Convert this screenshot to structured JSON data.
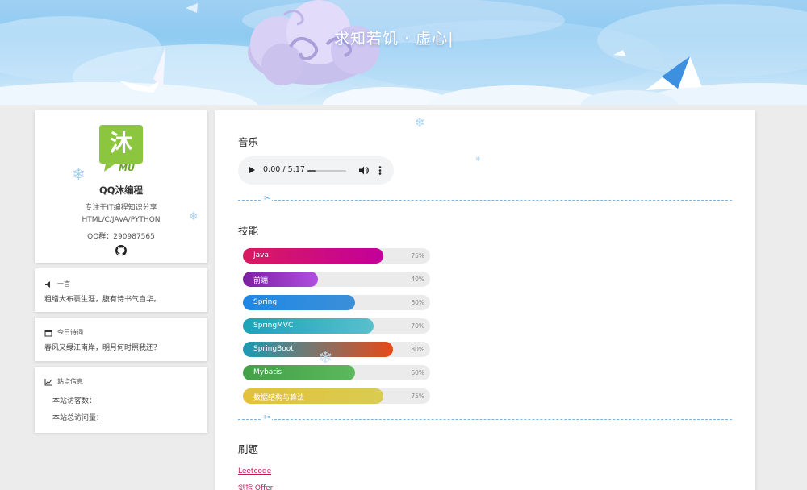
{
  "banner": {
    "title": "求知若饥 · 虚心|"
  },
  "profile": {
    "logo_text": "沐",
    "logo_sub": "MU",
    "name": "QQ沐编程",
    "tagline": "专注于IT编程知识分享",
    "languages": "HTML/C/JAVA/PYTHON",
    "qq_group": "QQ群：290987565",
    "icon": "github-icon"
  },
  "quote_card": {
    "title": "一言",
    "icon": "megaphone-icon",
    "text": "粗缯大布裹生涯，腹有诗书气自华。"
  },
  "poem_card": {
    "title": "今日诗词",
    "icon": "calendar-icon",
    "text": "春风又绿江南岸，明月何时照我还？"
  },
  "site_card": {
    "title": "站点信息",
    "icon": "chart-line-icon",
    "visitors": "本站访客数：",
    "views": "本站总访问量："
  },
  "music": {
    "title": "音乐",
    "time": "0:00 / 5:17",
    "progress": 0.2
  },
  "skills": {
    "title": "技能",
    "items": [
      {
        "name": "Java",
        "pct": "75%",
        "value": 0.75,
        "color": "linear-gradient(90deg,#d81b60,#c2009a)"
      },
      {
        "name": "前端",
        "pct": "40%",
        "value": 0.4,
        "color": "linear-gradient(90deg,#7b1fa2,#b04fe0)"
      },
      {
        "name": "Spring",
        "pct": "60%",
        "value": 0.6,
        "color": "linear-gradient(90deg,#1e88e5,#3c8fd8)"
      },
      {
        "name": "SpringMVC",
        "pct": "70%",
        "value": 0.7,
        "color": "linear-gradient(90deg,#1aa3b8,#58c0cc)"
      },
      {
        "name": "SpringBoot",
        "pct": "80%",
        "value": 0.8,
        "color": "linear-gradient(90deg,#1a9bb5,#e64a19)"
      },
      {
        "name": "Mybatis",
        "pct": "60%",
        "value": 0.6,
        "color": "linear-gradient(90deg,#43a047,#5cb85c)"
      },
      {
        "name": "数据结构与算法",
        "pct": "75%",
        "value": 0.75,
        "color": "linear-gradient(90deg,#e3c13a,#d9cc52)"
      }
    ]
  },
  "practice": {
    "title": "刷题",
    "links": [
      "Leetcode",
      "剑指 Offer"
    ]
  }
}
